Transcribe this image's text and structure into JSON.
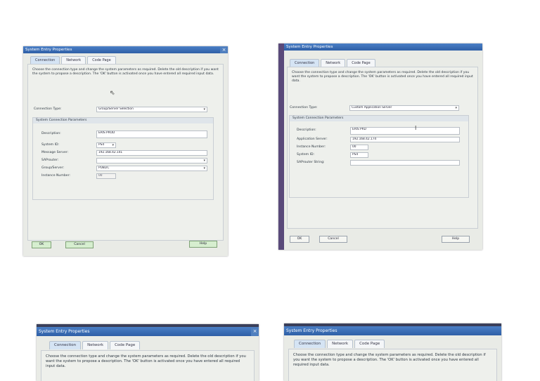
{
  "dialog": {
    "title": "System Entry Properties",
    "close_label": "×",
    "tabs": [
      "Connection",
      "Network",
      "Code Page"
    ],
    "description": "Choose the connection type and change the system parameters as required. Delete the old description if you want the system to propose a description. The 'OK' button is activated once you have entered all required input data.",
    "ok_label": "OK",
    "cancel_label": "Cancel",
    "help_label": "Help"
  },
  "shot1": {
    "connection_type_label": "Connection Type:",
    "connection_type_value": "Group/Server Selection",
    "params_header": "System Connection Parameters",
    "description_label": "Description:",
    "description_value": "ERIS PROD",
    "system_id_label": "System ID:",
    "system_id_value": "PS4",
    "message_server_label": "Message Server:",
    "message_server_value": "192.168.42.141",
    "saprouter_label": "SAProuter:",
    "saprouter_value": "",
    "group_server_label": "Group/Server:",
    "group_server_value": "PUBLIC",
    "instance_number_label": "Instance Number:",
    "instance_number_value": "00"
  },
  "shot2": {
    "connection_type_label": "Connection Type:",
    "connection_type_value": "Custom Application Server",
    "params_header": "System Connection Parameters",
    "description_label": "Description:",
    "description_value": "ERIS PRD",
    "app_server_label": "Application Server:",
    "app_server_value": "192.168.42.174",
    "instance_number_label": "Instance Number:",
    "instance_number_value": "00",
    "system_id_label": "System ID:",
    "system_id_value": "PS4",
    "saprouter_string_label": "SAProuter String:",
    "saprouter_string_value": ""
  }
}
